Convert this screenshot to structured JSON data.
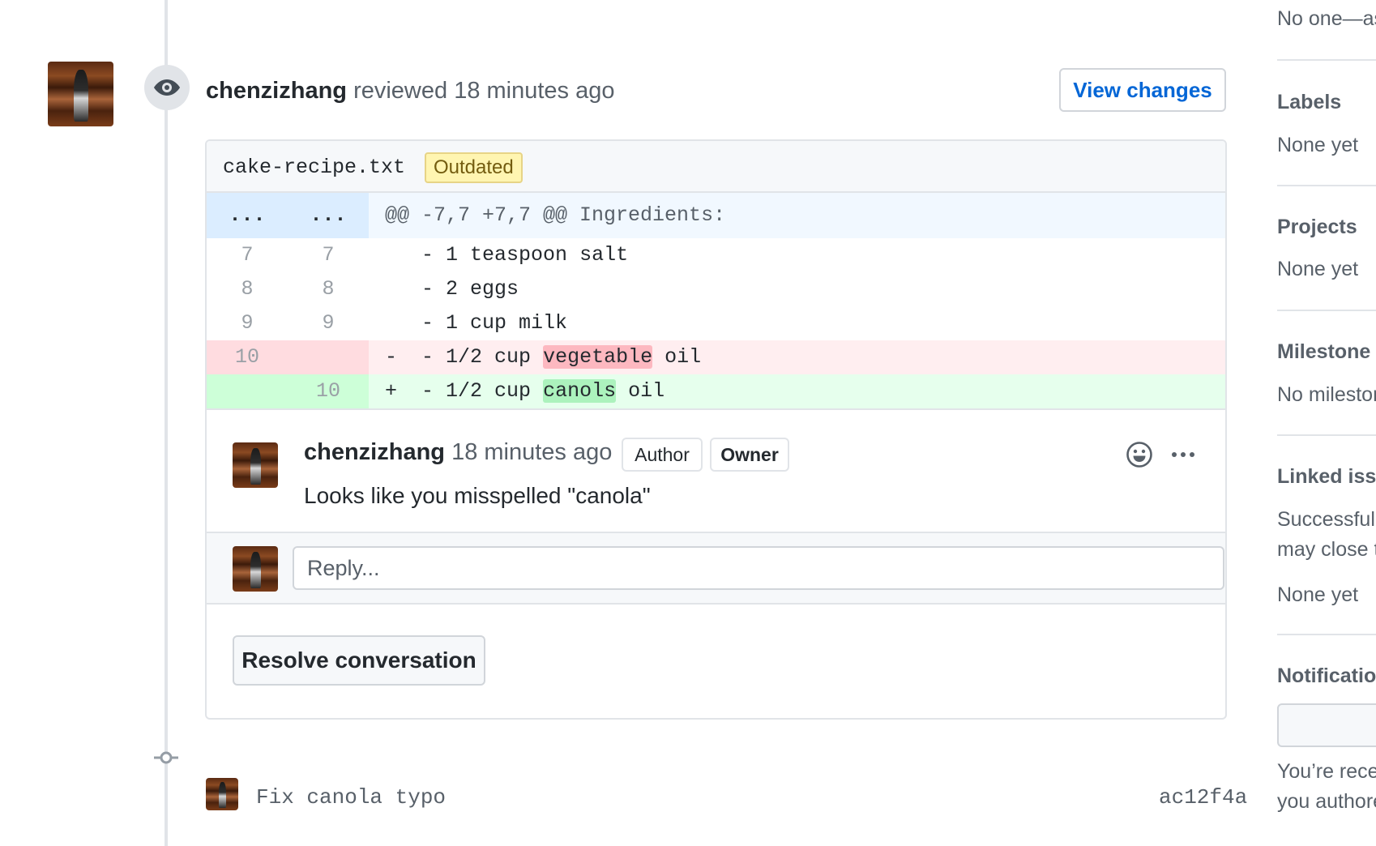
{
  "review": {
    "user": "chenzizhang",
    "action": "reviewed",
    "time": "18 minutes ago",
    "view_changes_label": "View changes"
  },
  "file": {
    "name": "cake-recipe.txt",
    "badge": "Outdated",
    "hunk": {
      "old_marker": "...",
      "new_marker": "...",
      "text": "@@ -7,7 +7,7 @@ Ingredients:"
    },
    "lines": [
      {
        "old": "7",
        "new": "7",
        "prefix": " ",
        "text": "- 1 teaspoon salt"
      },
      {
        "old": "8",
        "new": "8",
        "prefix": " ",
        "text": "- 2 eggs"
      },
      {
        "old": "9",
        "new": "9",
        "prefix": " ",
        "text": "- 1 cup milk"
      }
    ],
    "deleted": {
      "old": "10",
      "prefix": "-",
      "before": "- 1/2 cup ",
      "highlight": "vegetable",
      "after": " oil"
    },
    "added": {
      "new": "10",
      "prefix": "+",
      "before": "- 1/2 cup ",
      "highlight": "canols",
      "after": " oil"
    }
  },
  "comment": {
    "user": "chenzizhang",
    "time": "18 minutes ago",
    "badges": [
      "Author",
      "Owner"
    ],
    "body": "Looks like you misspelled \"canola\""
  },
  "reply": {
    "placeholder": "Reply..."
  },
  "resolve_label": "Resolve conversation",
  "commit": {
    "message": "Fix canola typo",
    "sha": "ac12f4a"
  },
  "sidebar": {
    "assignees_value": "No one—assign yourself",
    "labels": {
      "heading": "Labels",
      "value": "None yet"
    },
    "projects": {
      "heading": "Projects",
      "value": "None yet"
    },
    "milestone": {
      "heading": "Milestone",
      "value": "No milestone"
    },
    "linked": {
      "heading": "Linked issues",
      "desc_line1": "Successfully merging this pull request",
      "desc_line2": "may close these issues.",
      "value": "None yet"
    },
    "notifications": {
      "heading": "Notifications",
      "desc_line1": "You’re receiving notifications because",
      "desc_line2": "you authored the thread."
    }
  }
}
